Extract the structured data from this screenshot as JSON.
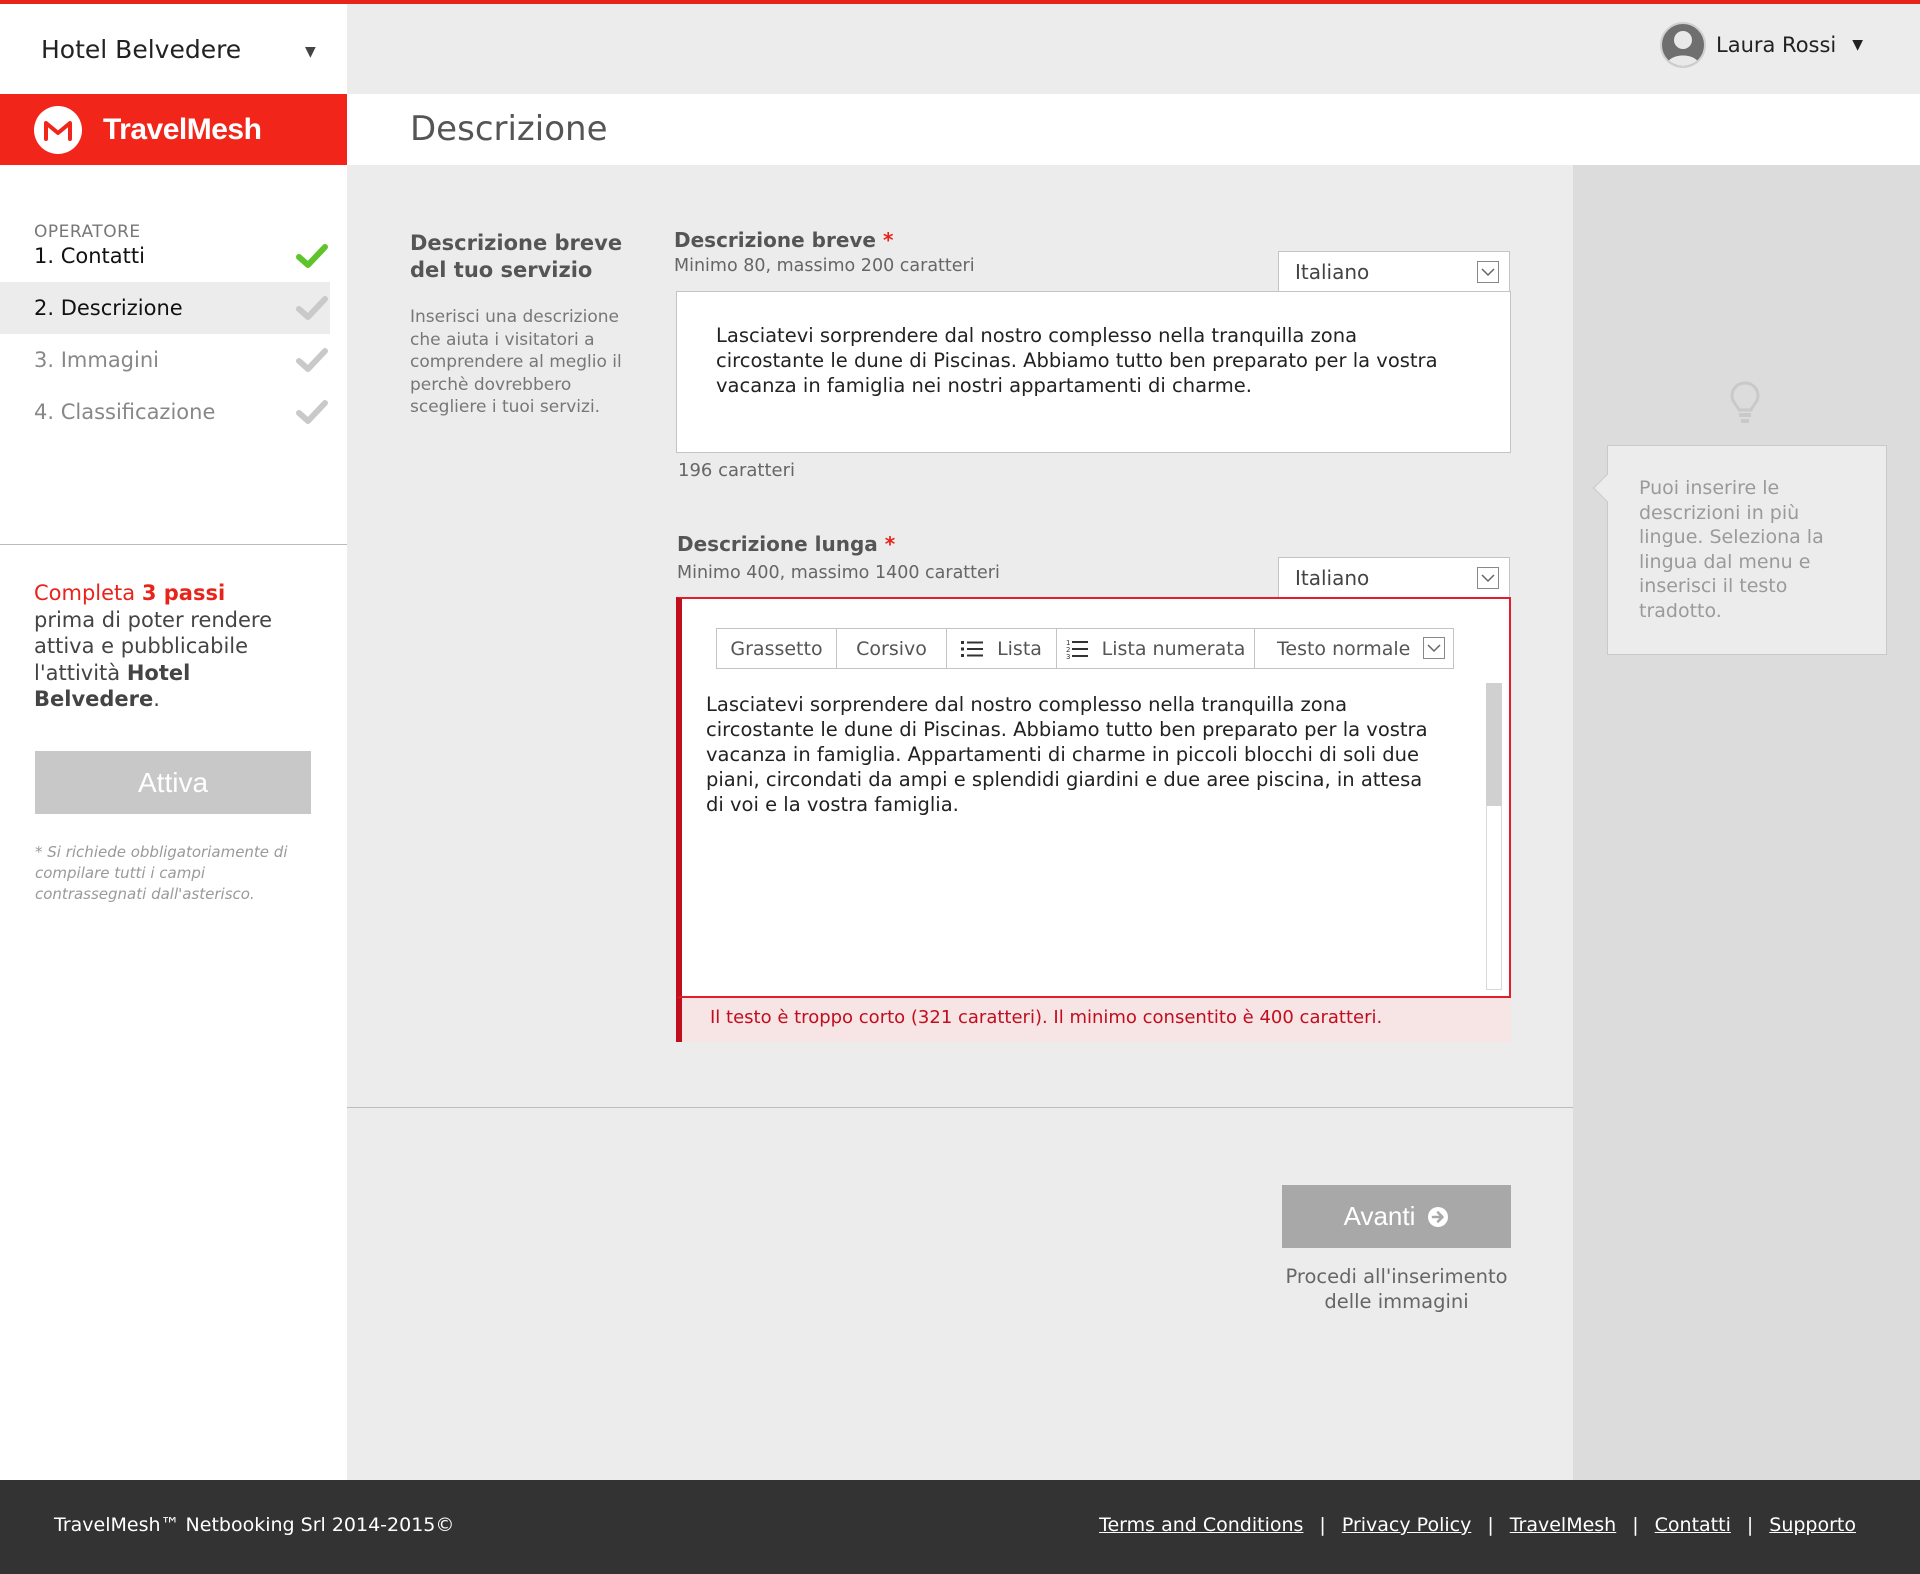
{
  "hotel_selector": {
    "name": "Hotel Belvedere",
    "caret": "▼"
  },
  "brand": {
    "name": "TravelMesh",
    "color": "#f2251b"
  },
  "user": {
    "name": "Laura Rossi",
    "caret": "▼"
  },
  "page": {
    "title": "Descrizione"
  },
  "sidebar": {
    "steps_title": "OPERATORE",
    "steps": [
      {
        "label": "1. Contatti",
        "state": "done"
      },
      {
        "label": "2. Descrizione",
        "state": "active"
      },
      {
        "label": "3. Immagini",
        "state": "todo"
      },
      {
        "label": "4. Classificazione",
        "state": "todo"
      }
    ],
    "complete": {
      "prefix": "Completa ",
      "count": "3 passi",
      "middle": "prima di poter rendere attiva e pubblicabile l'attività ",
      "hotel": "Hotel Belvedere",
      "suffix": "."
    },
    "activate_button": "Attiva",
    "required_note": "* Si richiede obbligatoriamente di compilare tutti i campi contrassegnati dall'asterisco."
  },
  "section": {
    "heading": "Descrizione breve del tuo servizio",
    "description": "Inserisci una descrizione che aiuta i visitatori a comprendere al meglio il perchè dovrebbero scegliere i tuoi servizi."
  },
  "short_description": {
    "label": "Descrizione breve",
    "asterisk": "*",
    "hint": "Minimo 80, massimo 200 caratteri",
    "language": "Italiano",
    "text": "Lasciatevi sorprendere dal nostro complesso nella tranquilla zona circostante le dune di Piscinas. Abbiamo tutto ben preparato per la vostra vacanza in famiglia nei nostri appartamenti di charme.",
    "char_count": "196 caratteri"
  },
  "long_description": {
    "label": "Descrizione lunga",
    "asterisk": "*",
    "hint": "Minimo 400, massimo 1400 caratteri",
    "language": "Italiano",
    "toolbar": {
      "bold": "Grassetto",
      "italic": "Corsivo",
      "list": "Lista",
      "numbered_list": "Lista numerata",
      "text_style": "Testo normale"
    },
    "text": "Lasciatevi sorprendere dal nostro complesso nella tranquilla zona circostante le dune di Piscinas. Abbiamo tutto ben preparato per la vostra vacanza in famiglia. Appartamenti di charme in piccoli blocchi di soli due piani, circondati da ampi e splendidi giardini e due aree piscina, in attesa di voi e la vostra famiglia.",
    "error": "Il testo è troppo corto (321 caratteri). Il minimo consentito è 400 caratteri.",
    "error_color": "#c10e1f"
  },
  "tip": {
    "icon": "lightbulb-icon",
    "text": "Puoi inserire le descrizioni in più lingue. Seleziona la lingua dal menu e inserisci il testo tradotto."
  },
  "next": {
    "button": "Avanti",
    "hint": "Procedi all'inserimento delle immagini"
  },
  "footer": {
    "copyright": "TravelMesh™ Netbooking Srl 2014-2015©",
    "links": [
      "Terms and Conditions",
      "Privacy Policy",
      "TravelMesh",
      "Contatti",
      "Supporto"
    ],
    "separator": "|"
  }
}
